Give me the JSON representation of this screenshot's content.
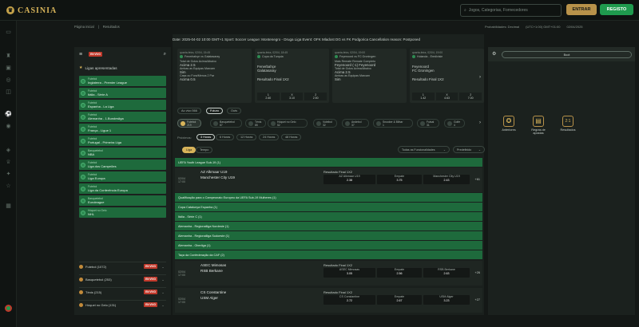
{
  "header": {
    "brand": "CASINIA",
    "search_placeholder": "Jogos, Categorias, Fornecedores",
    "login": "ENTRAR",
    "register": "REGISTO"
  },
  "breadcrumb": [
    "Página inicial",
    "Resultados"
  ],
  "header_info": [
    "Probabilidades: Decimal",
    "(UTC+1:00) GMT+01:00",
    "02/04/2025"
  ],
  "ticker": "Date: 2025-04-02 10:00 GMT+1 Sport: Soccer League: Montenegro - Druga Liga Event: OFK Mladost DG vs FK Podgorica Cancellation reason: Postponed",
  "left": {
    "new_badge": "EN VIVO",
    "featured_title": "Ligas apresentadas",
    "featured": [
      {
        "cat": "Futebol",
        "name": "Inglaterra - Premier League"
      },
      {
        "cat": "Futebol",
        "name": "Itália - Série A"
      },
      {
        "cat": "Futebol",
        "name": "Espanha - La Liga"
      },
      {
        "cat": "Futebol",
        "name": "Alemanha - 1.Bundesliga"
      },
      {
        "cat": "Futebol",
        "name": "França - Ligue 1"
      },
      {
        "cat": "Futebol",
        "name": "Portugal - Primeira Liga"
      },
      {
        "cat": "Basquetebol",
        "name": "NBA"
      },
      {
        "cat": "Futebol",
        "name": "Liga dos Campeões"
      },
      {
        "cat": "Futebol",
        "name": "Liga Europa"
      },
      {
        "cat": "Futebol",
        "name": "Liga da Conferência Europa"
      },
      {
        "cat": "Basquetebol",
        "name": "Euroleague"
      },
      {
        "cat": "Hóquei no Gelo",
        "name": "NHL"
      }
    ],
    "sports": [
      {
        "name": "Futebol (1072)",
        "badge": "EN VIVO"
      },
      {
        "name": "Basquetebol (253)",
        "badge": "EN VIVO"
      },
      {
        "name": "Ténis (215)",
        "badge": "EN VIVO"
      },
      {
        "name": "Hóquei no Gelo (131)",
        "badge": "EN VIVO"
      }
    ]
  },
  "cards": [
    {
      "date": "quarta-feira, 02/04, 15:45",
      "comp": "Fenerbahçe vs Galatasaray",
      "lines": [
        "Total de Golos Acima/Abaixo",
        "Acima 2.5",
        "Ambas as Equipas Marcam",
        "Sim",
        "Casa ou Fora/Menos 2 Par",
        "Acima 0.5"
      ],
      "odds": [
        [
          "1",
          "2.60"
        ],
        [
          "X",
          "3.10"
        ],
        [
          "2",
          "2.50"
        ]
      ]
    },
    {
      "date": "quarta-feira, 02/04, 18:45",
      "comp": "Copa da Turquia",
      "lines": [
        "Fenerbahçe",
        "Galatasaray",
        "",
        "Resultado Final 1X2"
      ],
      "odds": [
        [
          "1",
          "2.60"
        ],
        [
          "X",
          "3.10"
        ],
        [
          "2",
          "2.50"
        ]
      ]
    },
    {
      "date": "quarta-feira, 02/04, 19:00",
      "comp": "Feyenoord vs FC Groningen",
      "lines": [
        "Mais Remate Remate Completo",
        "Feyenoord (-1) Feyenoord",
        "Total de Golos Acima/Abaixo",
        "Acima 2.5",
        "Ambas as Equipas Marcam",
        "Sim"
      ],
      "odds": []
    },
    {
      "date": "quarta-feira, 02/04, 19:00",
      "comp": "Holanda - Eredivisie",
      "lines": [
        "Feyenoord",
        "FC Groningen",
        "",
        "Resultado Final 1X2"
      ],
      "odds": [
        [
          "1",
          "1.42"
        ],
        [
          "X",
          "4.63"
        ],
        [
          "2",
          "7.00"
        ]
      ]
    }
  ],
  "tabs": [
    {
      "label": "Ao vivo 566"
    },
    {
      "label": "Futuro"
    },
    {
      "label": "Outs"
    }
  ],
  "sports": [
    {
      "label": "Futebol",
      "count": "219"
    },
    {
      "label": "Basquetebol",
      "count": "87"
    },
    {
      "label": "Ténis",
      "count": "85"
    },
    {
      "label": "Hóquei no Gelo",
      "count": "52"
    },
    {
      "label": "Voleibol",
      "count": "32"
    },
    {
      "label": "Andebol",
      "count": "37"
    },
    {
      "label": "Snooker & Bilhar",
      "count": "1"
    },
    {
      "label": "Futsal",
      "count": "31"
    },
    {
      "label": "Golfe",
      "count": "4"
    }
  ],
  "times_label": "Próximos:",
  "times": [
    "3 Horas",
    "6 Horas",
    "12 Horas",
    "24 Horas",
    "48 Horas"
  ],
  "view_tabs": [
    "Liga",
    "Tempo"
  ],
  "filters": [
    "Todas as Funcionalidades",
    "Predefinido"
  ],
  "groups": [
    {
      "name": "UEFA Youth League Sub-19 (1)"
    },
    {
      "name": "Qualificação para o Campeonato Europeu da UEFA Sub-19 Mulheres (1)"
    },
    {
      "name": "Copa Catalunya Espanha (1)"
    },
    {
      "name": "Itália - Série C (1)"
    },
    {
      "name": "Alemanha - Regionalliga Nordeste (1)"
    },
    {
      "name": "Alemanha - Regionalliga Sudoeste (1)"
    },
    {
      "name": "Alemanha - Oberliga (1)"
    },
    {
      "name": "Taça da Confederação da CAF (2)"
    }
  ],
  "matches": [
    {
      "date": "02/04",
      "time": "17:00",
      "home": "AZ Alkmaar U19",
      "away": "Manchester City U19",
      "market": "Resultado Final 1X2",
      "o1n": "AZ Alkmaar U19",
      "o1": "2.38",
      "oxn": "Empate",
      "ox": "3.75",
      "o2n": "Manchester City U19",
      "o2": "2.43",
      "more": "+61"
    },
    {
      "date": "02/04",
      "time": "17:00",
      "home": "ASEC Mimosas",
      "away": "RSB Berkane",
      "market": "Resultado Final 1X2",
      "o1n": "ASEC Mimosas",
      "o1": "3.05",
      "oxn": "Empate",
      "ox": "2.56",
      "o2n": "RSB Berkane",
      "o2": "2.63",
      "more": "+26"
    },
    {
      "date": "02/04",
      "time": "17:00",
      "home": "CS Constantine",
      "away": "USM Alger",
      "market": "Resultado Final 1X2",
      "o1n": "CS Constantine",
      "o1": "2.72",
      "oxn": "Empate",
      "ox": "2.67",
      "o2n": "USM Alger",
      "o2": "3.23",
      "more": "+27"
    }
  ],
  "right": {
    "button": "Boot",
    "icons": [
      {
        "label": "Anteriores",
        "icon": "✪"
      },
      {
        "label": "Regras de apostas",
        "icon": "▤"
      },
      {
        "label": "Resultados",
        "icon": "2:1"
      }
    ]
  }
}
